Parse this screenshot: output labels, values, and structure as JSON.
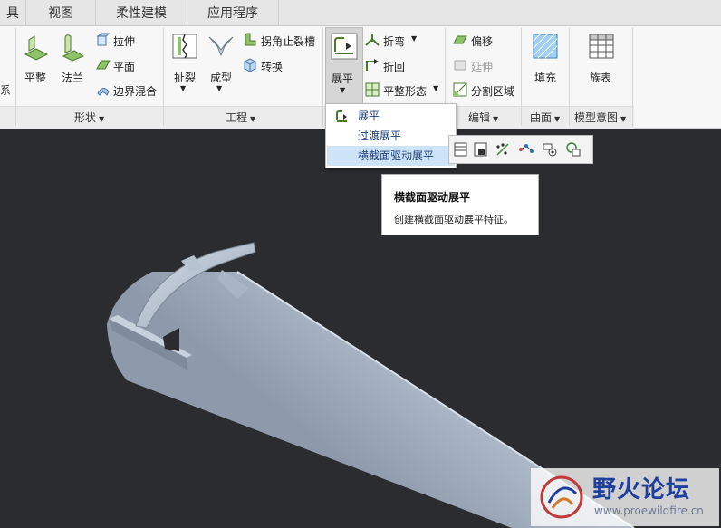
{
  "tabs": [
    {
      "label": "具"
    },
    {
      "label": "视图"
    },
    {
      "label": "柔性建模"
    },
    {
      "label": "应用程序"
    }
  ],
  "ribbon": {
    "left_cut_label": "系",
    "shape_group": {
      "label": "形状",
      "flat_wall": "平整",
      "flange": "法兰",
      "extrude": "拉伸",
      "planar": "平面",
      "boundary_blend": "边界混合"
    },
    "engineering_group": {
      "label": "工程",
      "rip": "扯裂",
      "form": "成型",
      "corner_relief": "拐角止裂槽",
      "convert": "转换"
    },
    "bends_group": {
      "unbend": "展平",
      "bend": "折弯",
      "bend_back": "折回",
      "flat_pattern": "平整形态"
    },
    "editing_group": {
      "label": "编辑",
      "offset": "偏移",
      "extend": "延伸",
      "split_area": "分割区域"
    },
    "surfaces_group": {
      "label": "曲面",
      "fill": "填充"
    },
    "model_intent_group": {
      "label": "模型意图",
      "family_table": "族表"
    }
  },
  "dropdown": {
    "items": [
      {
        "label": "展平"
      },
      {
        "label": "过渡展平"
      },
      {
        "label": "横截面驱动展平"
      }
    ]
  },
  "tooltip": {
    "title": "横截面驱动展平",
    "description": "创建横截面驱动展平特征。"
  },
  "watermark": {
    "title": "野火论坛",
    "url": "www.proewildfire.cn"
  },
  "colors": {
    "part_body": "#b4c0d0",
    "viewport_bg": "#2a2c30",
    "menu_highlight": "#cfe3f6",
    "ribbon_bg": "#f7f7f7"
  }
}
